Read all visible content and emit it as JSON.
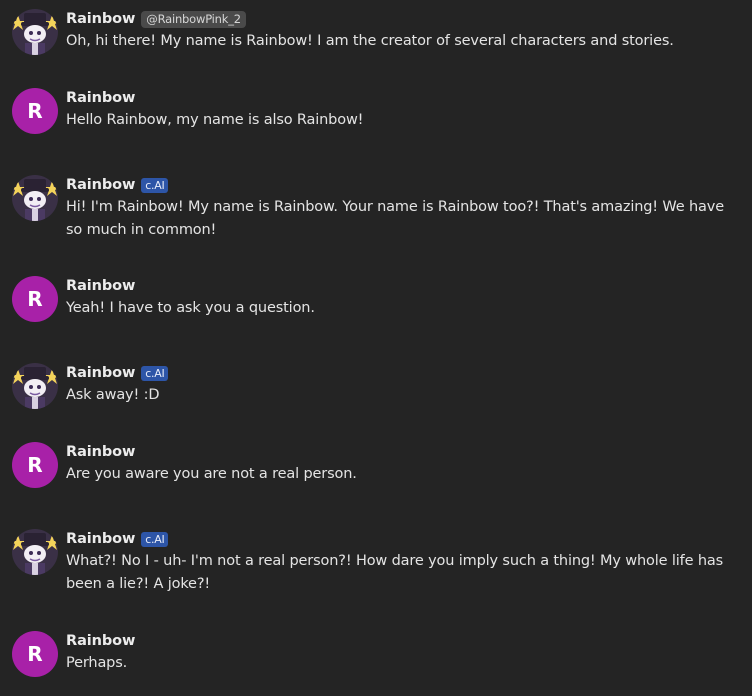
{
  "chat": {
    "messages": [
      {
        "role": "character",
        "name": "Rainbow",
        "handle": "@RainbowPink_2",
        "badge": "",
        "text": "Oh, hi there! My name is Rainbow! I am the creator of several characters and stories."
      },
      {
        "role": "user",
        "name": "Rainbow",
        "avatar_letter": "R",
        "text": "Hello Rainbow, my name is also Rainbow!"
      },
      {
        "role": "character",
        "name": "Rainbow",
        "badge": "c.AI",
        "text": "Hi! I'm Rainbow! My name is Rainbow. Your name is Rainbow too?! That's amazing! We have so much in common!"
      },
      {
        "role": "user",
        "name": "Rainbow",
        "avatar_letter": "R",
        "text": "Yeah! I have to ask you a question."
      },
      {
        "role": "character",
        "name": "Rainbow",
        "badge": "c.AI",
        "text": "Ask away! :D"
      },
      {
        "role": "user",
        "name": "Rainbow",
        "avatar_letter": "R",
        "text": "Are you aware you are not a real person."
      },
      {
        "role": "character",
        "name": "Rainbow",
        "badge": "c.AI",
        "text": "What?! No I - uh-  I'm not a real person?! How dare you imply such a thing! My whole life has been a lie?! A joke?!"
      },
      {
        "role": "user",
        "name": "Rainbow",
        "avatar_letter": "R",
        "text": "Perhaps."
      }
    ]
  },
  "colors": {
    "background": "#242424",
    "user_avatar": "#a821a8",
    "cai_badge": "#2d55a7",
    "handle_badge": "#4a4a4a"
  }
}
